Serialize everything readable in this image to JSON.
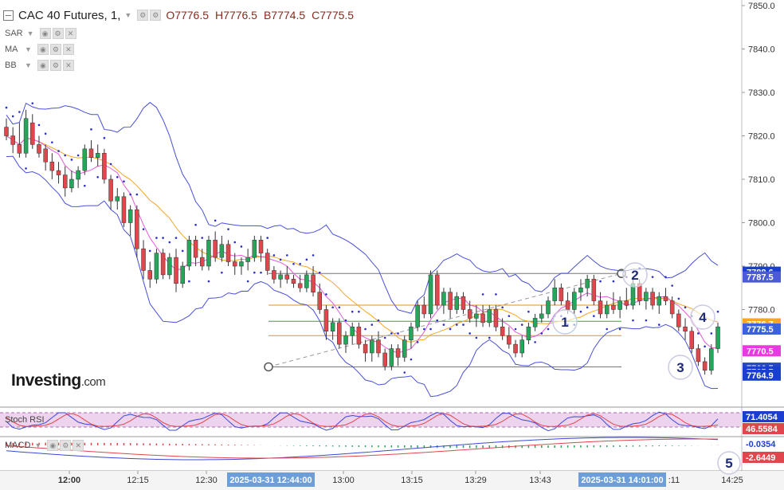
{
  "header": {
    "title": "CAC 40 Futures, 1,",
    "open": "O7776.5",
    "high": "H7776.5",
    "bid": "B7774.5",
    "close": "C7775.5"
  },
  "indicators": [
    "SAR",
    "MA",
    "BB"
  ],
  "watermark": {
    "brand": "Investing",
    "domain": ".com"
  },
  "colors": {
    "bull": "#26a65b",
    "bear": "#e0474c",
    "bb": "#4a4fd8",
    "sar": "#2a2fc8",
    "ma_fast": "#e65ad8",
    "ma_slow": "#f5a623",
    "level_orange": "#f28c1a",
    "level_green": "#2eaa2e",
    "stoch_band": "#e8c8ea",
    "stoch_k": "#3b48d6",
    "stoch_d": "#e0474c",
    "macd_line": "#3b48d6",
    "macd_signal": "#e0474c",
    "annotation": "#1f2a78"
  },
  "chart_data": [
    {
      "type": "candlestick",
      "y_axis": {
        "ylim": [
          7762,
          7851
        ],
        "ticks": [
          7850.0,
          7840.0,
          7830.0,
          7820.0,
          7810.0,
          7800.0,
          7790.0,
          7780.0
        ]
      },
      "x_axis": {
        "ticks": [
          "12:00",
          "12:15",
          "12:30",
          "13:00",
          "13:15",
          "13:29",
          "13:43",
          "14:25"
        ],
        "crosshair_labels": [
          "2025-03-31 12:44:00",
          "2025-03-31 14:01:00"
        ],
        "partial_label": ":11"
      },
      "ohlc": [
        [
          7822,
          7824,
          7819,
          7820
        ],
        [
          7820,
          7822,
          7816,
          7818
        ],
        [
          7818,
          7823,
          7815,
          7816
        ],
        [
          7816,
          7826,
          7815,
          7824
        ],
        [
          7823,
          7825,
          7817,
          7818
        ],
        [
          7818,
          7820,
          7815,
          7816
        ],
        [
          7817,
          7818,
          7812,
          7814
        ],
        [
          7814,
          7816,
          7810,
          7812
        ],
        [
          7812,
          7814,
          7809,
          7811
        ],
        [
          7811,
          7813,
          7806,
          7808
        ],
        [
          7808,
          7812,
          7807,
          7810
        ],
        [
          7810,
          7813,
          7808,
          7812
        ],
        [
          7812,
          7818,
          7811,
          7817
        ],
        [
          7817,
          7819,
          7814,
          7815
        ],
        [
          7815,
          7818,
          7813,
          7816
        ],
        [
          7816,
          7817,
          7809,
          7810
        ],
        [
          7810,
          7811,
          7803,
          7805
        ],
        [
          7805,
          7808,
          7803,
          7806
        ],
        [
          7806,
          7807,
          7799,
          7800
        ],
        [
          7800,
          7804,
          7797,
          7803
        ],
        [
          7803,
          7804,
          7792,
          7794
        ],
        [
          7794,
          7796,
          7787,
          7789
        ],
        [
          7789,
          7791,
          7785,
          7787
        ],
        [
          7787,
          7794,
          7786,
          7793
        ],
        [
          7793,
          7794,
          7787,
          7788
        ],
        [
          7788,
          7793,
          7787,
          7792
        ],
        [
          7792,
          7794,
          7784,
          7786
        ],
        [
          7786,
          7791,
          7785,
          7790
        ],
        [
          7790,
          7797,
          7789,
          7796
        ],
        [
          7796,
          7797,
          7790,
          7792
        ],
        [
          7792,
          7794,
          7789,
          7790
        ],
        [
          7790,
          7797,
          7789,
          7796
        ],
        [
          7796,
          7798,
          7791,
          7792
        ],
        [
          7792,
          7797,
          7791,
          7795
        ],
        [
          7795,
          7796,
          7790,
          7791
        ],
        [
          7791,
          7793,
          7788,
          7790
        ],
        [
          7790,
          7792,
          7788,
          7791
        ],
        [
          7791,
          7794,
          7789,
          7792
        ],
        [
          7792,
          7797,
          7791,
          7796
        ],
        [
          7796,
          7797,
          7791,
          7793
        ],
        [
          7793,
          7794,
          7788,
          7789
        ],
        [
          7789,
          7790,
          7786,
          7787
        ],
        [
          7787,
          7789,
          7785,
          7788
        ],
        [
          7788,
          7790,
          7786,
          7787
        ],
        [
          7787,
          7788,
          7785,
          7786
        ],
        [
          7786,
          7788,
          7784,
          7785
        ],
        [
          7785,
          7789,
          7784,
          7788
        ],
        [
          7788,
          7790,
          7783,
          7784
        ],
        [
          7784,
          7786,
          7779,
          7780
        ],
        [
          7780,
          7781,
          7773,
          7775
        ],
        [
          7775,
          7778,
          7773,
          7777
        ],
        [
          7777,
          7778,
          7771,
          7772
        ],
        [
          7772,
          7775,
          7770,
          7774
        ],
        [
          7774,
          7777,
          7772,
          7776
        ],
        [
          7776,
          7777,
          7771,
          7772
        ],
        [
          7772,
          7773,
          7768,
          7770
        ],
        [
          7770,
          7774,
          7768,
          7773
        ],
        [
          7773,
          7775,
          7769,
          7770
        ],
        [
          7770,
          7771,
          7766,
          7767
        ],
        [
          7767,
          7772,
          7766,
          7771
        ],
        [
          7771,
          7772,
          7767,
          7769
        ],
        [
          7769,
          7774,
          7768,
          7773
        ],
        [
          7773,
          7777,
          7771,
          7776
        ],
        [
          7776,
          7782,
          7775,
          7781
        ],
        [
          7781,
          7783,
          7778,
          7779
        ],
        [
          7779,
          7789,
          7778,
          7788
        ],
        [
          7788,
          7789,
          7780,
          7781
        ],
        [
          7781,
          7785,
          7779,
          7784
        ],
        [
          7784,
          7785,
          7778,
          7780
        ],
        [
          7780,
          7784,
          7779,
          7783
        ],
        [
          7783,
          7784,
          7779,
          7780
        ],
        [
          7780,
          7782,
          7777,
          7778
        ],
        [
          7778,
          7781,
          7776,
          7779
        ],
        [
          7779,
          7781,
          7776,
          7777
        ],
        [
          7777,
          7781,
          7776,
          7780
        ],
        [
          7780,
          7781,
          7775,
          7776
        ],
        [
          7776,
          7778,
          7773,
          7774
        ],
        [
          7774,
          7776,
          7771,
          7772
        ],
        [
          7772,
          7773,
          7769,
          7770
        ],
        [
          7770,
          7774,
          7769,
          7773
        ],
        [
          7773,
          7777,
          7772,
          7776
        ],
        [
          7776,
          7779,
          7775,
          7778
        ],
        [
          7778,
          7781,
          7777,
          7779
        ],
        [
          7779,
          7783,
          7778,
          7782
        ],
        [
          7782,
          7787,
          7781,
          7785
        ],
        [
          7785,
          7786,
          7781,
          7782
        ],
        [
          7782,
          7784,
          7779,
          7780
        ],
        [
          7780,
          7785,
          7779,
          7784
        ],
        [
          7784,
          7787,
          7782,
          7785
        ],
        [
          7785,
          7788,
          7783,
          7787
        ],
        [
          7787,
          7788,
          7781,
          7782
        ],
        [
          7782,
          7784,
          7778,
          7779
        ],
        [
          7779,
          7782,
          7778,
          7781
        ],
        [
          7781,
          7784,
          7779,
          7780
        ],
        [
          7780,
          7783,
          7778,
          7782
        ],
        [
          7782,
          7785,
          7780,
          7781
        ],
        [
          7781,
          7787,
          7780,
          7786
        ],
        [
          7786,
          7787,
          7781,
          7782
        ],
        [
          7782,
          7785,
          7780,
          7784
        ],
        [
          7784,
          7785,
          7780,
          7781
        ],
        [
          7781,
          7784,
          7779,
          7783
        ],
        [
          7783,
          7785,
          7781,
          7782
        ],
        [
          7782,
          7783,
          7778,
          7779
        ],
        [
          7779,
          7780,
          7775,
          7776
        ],
        [
          7776,
          7778,
          7773,
          7775
        ],
        [
          7775,
          7776,
          7770,
          7771
        ],
        [
          7771,
          7772,
          7767,
          7768
        ],
        [
          7768,
          7769,
          7765,
          7766
        ],
        [
          7766,
          7772,
          7765,
          7771
        ],
        [
          7771,
          7777,
          7770,
          7776
        ]
      ],
      "price_labels": [
        {
          "value": 7788.6,
          "label": "7788.6",
          "color": "#1a3fd0"
        },
        {
          "value": 7787.5,
          "label": "7787.5",
          "color": "#4a5ad8"
        },
        {
          "value": 7776.7,
          "label": "7776.7",
          "color": "#f5a623"
        },
        {
          "value": 7775.5,
          "label": "7775.5",
          "color": "#3a62e0"
        },
        {
          "value": 7770.5,
          "label": "7770.5",
          "color": "#e83ae0"
        },
        {
          "value": 7766.5,
          "label": "7766.5",
          "color": "#2747c4"
        },
        {
          "value": 7765.7,
          "label": "7765.7",
          "color": "#1a3fd0"
        },
        {
          "value": 7764.9,
          "label": "7764.9",
          "color": "#1a3fd0"
        }
      ],
      "annotations": [
        "1",
        "2",
        "3",
        "4"
      ],
      "levels": [
        7788.3,
        7781.0,
        7777.3,
        7774.0,
        7766.8
      ]
    },
    {
      "type": "line",
      "name": "Stoch RSI",
      "value_labels": [
        "71.4054",
        "46.5584"
      ]
    },
    {
      "type": "line",
      "name": "MACD",
      "value_labels": [
        "-0.0354",
        "-2.6449"
      ],
      "annotation": "5"
    }
  ]
}
